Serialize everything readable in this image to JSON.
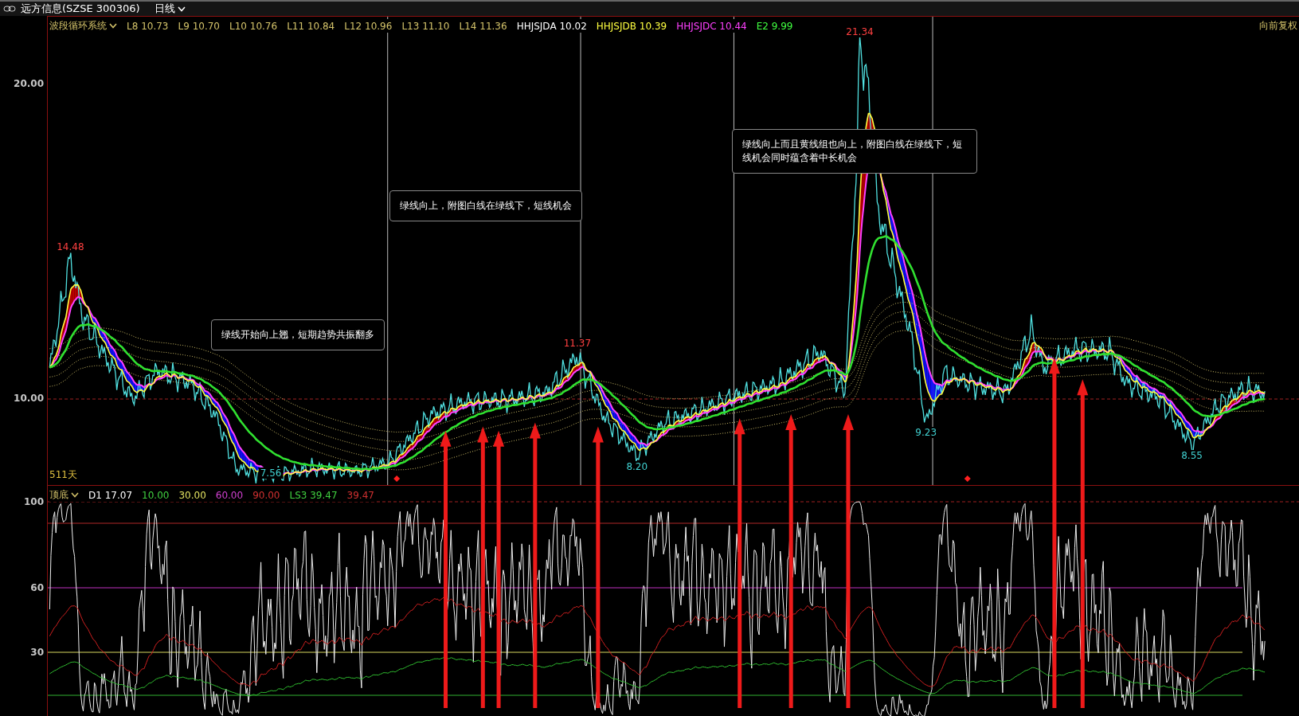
{
  "title_bar": {
    "symbol": "远方信息(SZSE 300306)",
    "period": "日线"
  },
  "price_panel": {
    "indicator_name": "波段循环系统",
    "adjust_label": "向前复权",
    "legend": [
      {
        "label": "L8 10.73",
        "color": "#d4c36a"
      },
      {
        "label": "L9 10.70",
        "color": "#d4c36a"
      },
      {
        "label": "L10 10.76",
        "color": "#d4c36a"
      },
      {
        "label": "L11 10.84",
        "color": "#d4c36a"
      },
      {
        "label": "L12 10.96",
        "color": "#d4c36a"
      },
      {
        "label": "L13 11.10",
        "color": "#d4c36a"
      },
      {
        "label": "L14 11.36",
        "color": "#d4c36a"
      },
      {
        "label": "HHJSJDA 10.02",
        "color": "#ffffff"
      },
      {
        "label": "HHJSJDB 10.39",
        "color": "#ffff40"
      },
      {
        "label": "HHJSJDC 10.44",
        "color": "#ff40ff"
      },
      {
        "label": "E2 9.99",
        "color": "#40ff40"
      }
    ],
    "y_labels": [
      "20.00",
      "10.00"
    ],
    "price_marks": [
      {
        "text": "14.48",
        "color": "#ff4040"
      },
      {
        "text": "7.56",
        "color": "#40d0d0"
      },
      {
        "text": "11.37",
        "color": "#ff4040"
      },
      {
        "text": "8.20",
        "color": "#40d0d0"
      },
      {
        "text": "21.34",
        "color": "#ff4040"
      },
      {
        "text": "9.23",
        "color": "#40d0d0"
      },
      {
        "text": "8.55",
        "color": "#40d0d0"
      }
    ],
    "days_label": "511天",
    "callouts": [
      "绿线开始向上翘，短期趋势共振翻多",
      "绿线向上，附图白线在绿线下，短线机会",
      "绿线向上而且黄线组也向上，附图白线在绿线下，短线机会同时蕴含着中长机会"
    ]
  },
  "oscillator_panel": {
    "indicator_name": "顶底",
    "legend": [
      {
        "label": "D1 17.07",
        "color": "#ffffff"
      },
      {
        "label": "10.00",
        "color": "#40d040"
      },
      {
        "label": "30.00",
        "color": "#e0e060"
      },
      {
        "label": "60.00",
        "color": "#d040d0"
      },
      {
        "label": "90.00",
        "color": "#d03030"
      },
      {
        "label": "LS3 39.47",
        "color": "#40d040"
      },
      {
        "label": "39.47",
        "color": "#d03030"
      }
    ],
    "y_labels": [
      "100",
      "60",
      "30"
    ]
  }
}
